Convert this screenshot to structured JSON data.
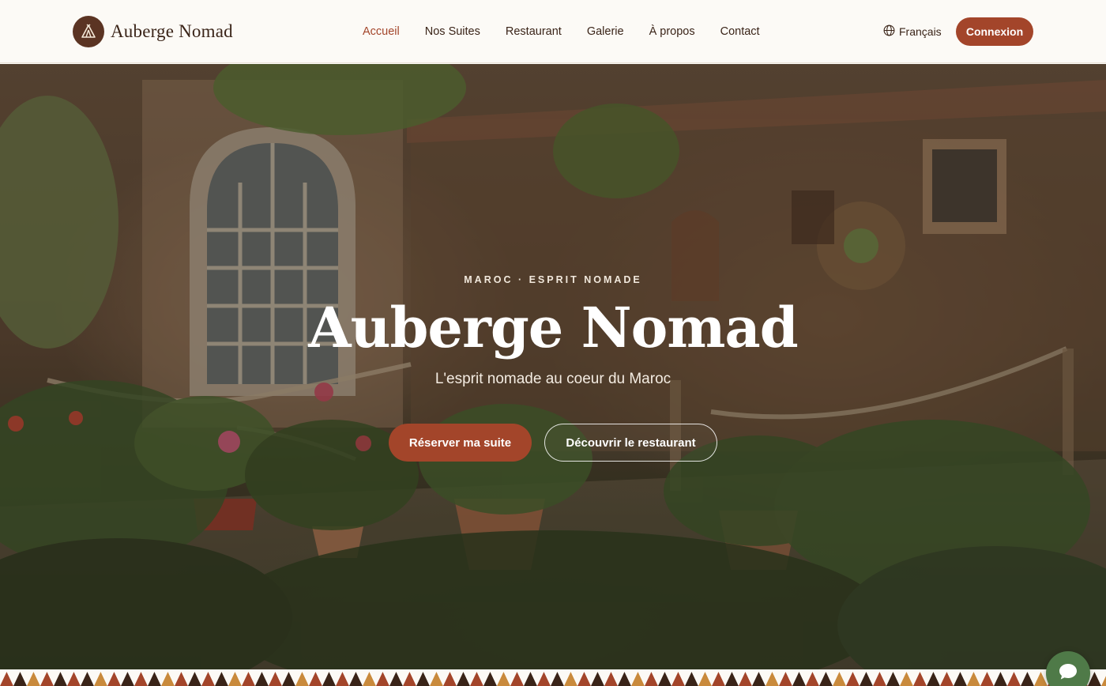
{
  "brand": {
    "name": "Auberge Nomad",
    "logo_icon": "tent-icon"
  },
  "nav": {
    "items": [
      {
        "label": "Accueil",
        "active": true
      },
      {
        "label": "Nos Suites",
        "active": false
      },
      {
        "label": "Restaurant",
        "active": false
      },
      {
        "label": "Galerie",
        "active": false
      },
      {
        "label": "À propos",
        "active": false
      },
      {
        "label": "Contact",
        "active": false
      }
    ]
  },
  "language": {
    "label": "Français",
    "icon": "globe-icon"
  },
  "auth": {
    "login_label": "Connexion"
  },
  "hero": {
    "eyebrow": "MAROC · ESPRIT NOMADE",
    "title": "Auberge Nomad",
    "subtitle": "L'esprit nomade au coeur du Maroc",
    "primary_cta": "Réserver ma suite",
    "secondary_cta": "Découvrir le restaurant"
  },
  "chat": {
    "icon": "chat-bubble-icon"
  },
  "colors": {
    "accent": "#a3452a",
    "brand_dark": "#5b3423",
    "text": "#3a2418",
    "header_bg": "#fcfaf6",
    "chat": "#4f7a48"
  }
}
